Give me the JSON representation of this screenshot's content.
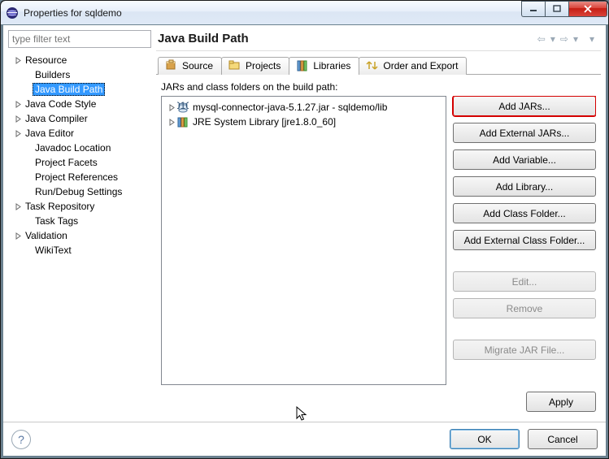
{
  "window": {
    "title": "Properties for sqldemo"
  },
  "filter": {
    "placeholder": "type filter text"
  },
  "tree": {
    "items": [
      {
        "label": "Resource",
        "expandable": true,
        "indent": 0
      },
      {
        "label": "Builders",
        "expandable": false,
        "indent": 1
      },
      {
        "label": "Java Build Path",
        "expandable": false,
        "indent": 1,
        "selected": true
      },
      {
        "label": "Java Code Style",
        "expandable": true,
        "indent": 0
      },
      {
        "label": "Java Compiler",
        "expandable": true,
        "indent": 0
      },
      {
        "label": "Java Editor",
        "expandable": true,
        "indent": 0
      },
      {
        "label": "Javadoc Location",
        "expandable": false,
        "indent": 1
      },
      {
        "label": "Project Facets",
        "expandable": false,
        "indent": 1
      },
      {
        "label": "Project References",
        "expandable": false,
        "indent": 1
      },
      {
        "label": "Run/Debug Settings",
        "expandable": false,
        "indent": 1
      },
      {
        "label": "Task Repository",
        "expandable": true,
        "indent": 0
      },
      {
        "label": "Task Tags",
        "expandable": false,
        "indent": 1
      },
      {
        "label": "Validation",
        "expandable": true,
        "indent": 0
      },
      {
        "label": "WikiText",
        "expandable": false,
        "indent": 1
      }
    ]
  },
  "right": {
    "title": "Java Build Path",
    "tabs": {
      "source": "Source",
      "projects": "Projects",
      "libraries": "Libraries",
      "order": "Order and Export"
    },
    "subhead": "JARs and class folders on the build path:",
    "list": {
      "items": [
        {
          "label": "mysql-connector-java-5.1.27.jar - sqldemo/lib",
          "icon": "jar"
        },
        {
          "label": "JRE System Library [jre1.8.0_60]",
          "icon": "jre"
        }
      ]
    },
    "buttons": {
      "add_jars": "Add JARs...",
      "add_external_jars": "Add External JARs...",
      "add_variable": "Add Variable...",
      "add_library": "Add Library...",
      "add_class_folder": "Add Class Folder...",
      "add_ext_class": "Add External Class Folder...",
      "edit": "Edit...",
      "remove": "Remove",
      "migrate": "Migrate JAR File...",
      "apply": "Apply"
    }
  },
  "bottom": {
    "ok": "OK",
    "cancel": "Cancel"
  }
}
